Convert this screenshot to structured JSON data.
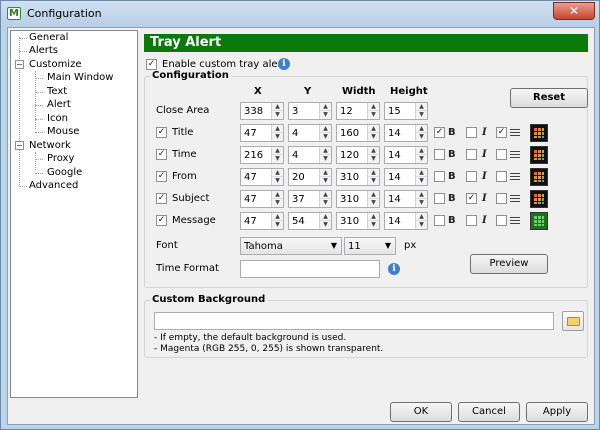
{
  "window": {
    "title": "Configuration",
    "app_icon_letter": "M",
    "close_glyph": "✕"
  },
  "tree": {
    "items": [
      {
        "label": "General"
      },
      {
        "label": "Alerts"
      },
      {
        "label": "Customize"
      },
      {
        "label": "Main Window"
      },
      {
        "label": "Text"
      },
      {
        "label": "Alert"
      },
      {
        "label": "Icon"
      },
      {
        "label": "Mouse"
      },
      {
        "label": "Network"
      },
      {
        "label": "Proxy"
      },
      {
        "label": "Google"
      },
      {
        "label": "Advanced"
      }
    ],
    "expander_glyph": "−"
  },
  "page": {
    "header": "Tray Alert",
    "enable_label": "Enable custom tray alert",
    "enable_checked": true
  },
  "config": {
    "group_title": "Configuration",
    "columns": {
      "x": "X",
      "y": "Y",
      "width": "Width",
      "height": "Height"
    },
    "reset_label": "Reset",
    "rows": [
      {
        "label": "Close Area",
        "has_checkbox": false,
        "x": "338",
        "y": "3",
        "width": "12",
        "height": "15"
      },
      {
        "label": "Title",
        "checked": true,
        "x": "47",
        "y": "4",
        "width": "160",
        "height": "14",
        "bold": true,
        "italic": false,
        "align": true,
        "color": "dark"
      },
      {
        "label": "Time",
        "checked": true,
        "x": "216",
        "y": "4",
        "width": "120",
        "height": "14",
        "bold": false,
        "italic": false,
        "align": false,
        "color": "dark"
      },
      {
        "label": "From",
        "checked": true,
        "x": "47",
        "y": "20",
        "width": "310",
        "height": "14",
        "bold": false,
        "italic": false,
        "align": false,
        "color": "dark"
      },
      {
        "label": "Subject",
        "checked": true,
        "x": "47",
        "y": "37",
        "width": "310",
        "height": "14",
        "bold": false,
        "italic": true,
        "align": false,
        "color": "dark"
      },
      {
        "label": "Message",
        "checked": true,
        "x": "47",
        "y": "54",
        "width": "310",
        "height": "14",
        "bold": false,
        "italic": false,
        "align": false,
        "color": "green"
      }
    ],
    "format_glyphs": {
      "bold": "B",
      "italic": "I",
      "check": "✓"
    },
    "font_label": "Font",
    "font_value": "Tahoma",
    "font_size_value": "11",
    "font_unit": "px",
    "time_format_label": "Time Format",
    "time_format_value": "",
    "preview_label": "Preview"
  },
  "background": {
    "group_title": "Custom Background",
    "path_value": "",
    "note1": "- If empty, the default background is used.",
    "note2": "- Magenta (RGB 255, 0, 255) is shown transparent."
  },
  "footer": {
    "ok": "OK",
    "cancel": "Cancel",
    "apply": "Apply"
  },
  "colors": {
    "header_bg": "#0b7a0b",
    "window_frame": "#bcd4e9"
  },
  "icons": {
    "info": "i",
    "spin_up": "▲",
    "spin_down": "▼",
    "combo_arrow": "▼"
  }
}
